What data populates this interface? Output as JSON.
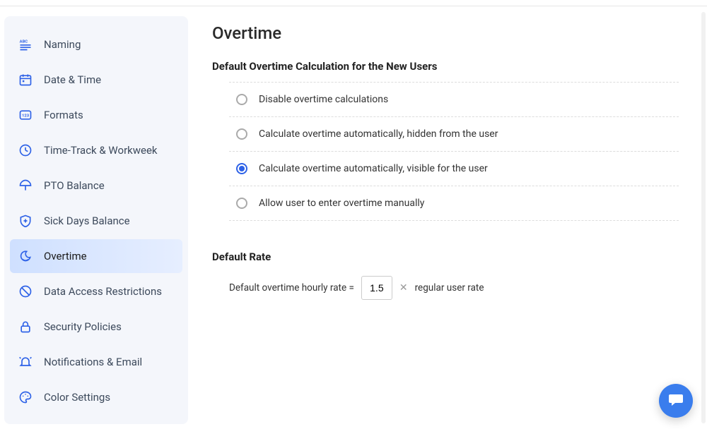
{
  "page": {
    "title": "Overtime"
  },
  "sidebar": {
    "items": [
      {
        "id": "naming",
        "label": "Naming",
        "active": false
      },
      {
        "id": "date-time",
        "label": "Date & Time",
        "active": false
      },
      {
        "id": "formats",
        "label": "Formats",
        "active": false
      },
      {
        "id": "time-track",
        "label": "Time-Track & Workweek",
        "active": false
      },
      {
        "id": "pto",
        "label": "PTO Balance",
        "active": false
      },
      {
        "id": "sick-days",
        "label": "Sick Days Balance",
        "active": false
      },
      {
        "id": "overtime",
        "label": "Overtime",
        "active": true
      },
      {
        "id": "data-access",
        "label": "Data Access Restrictions",
        "active": false
      },
      {
        "id": "security",
        "label": "Security Policies",
        "active": false
      },
      {
        "id": "notifications",
        "label": "Notifications & Email",
        "active": false
      },
      {
        "id": "color",
        "label": "Color Settings",
        "active": false
      }
    ]
  },
  "overtime_calc": {
    "heading": "Default Overtime Calculation for the New Users",
    "options": [
      {
        "label": "Disable overtime calculations",
        "selected": false
      },
      {
        "label": "Calculate overtime automatically, hidden from the user",
        "selected": false
      },
      {
        "label": "Calculate overtime automatically, visible for the user",
        "selected": true
      },
      {
        "label": "Allow user to enter overtime manually",
        "selected": false
      }
    ]
  },
  "default_rate": {
    "heading": "Default Rate",
    "prefix": "Default overtime hourly rate =",
    "value": "1.5",
    "mult_symbol": "✕",
    "suffix": "regular user rate"
  }
}
